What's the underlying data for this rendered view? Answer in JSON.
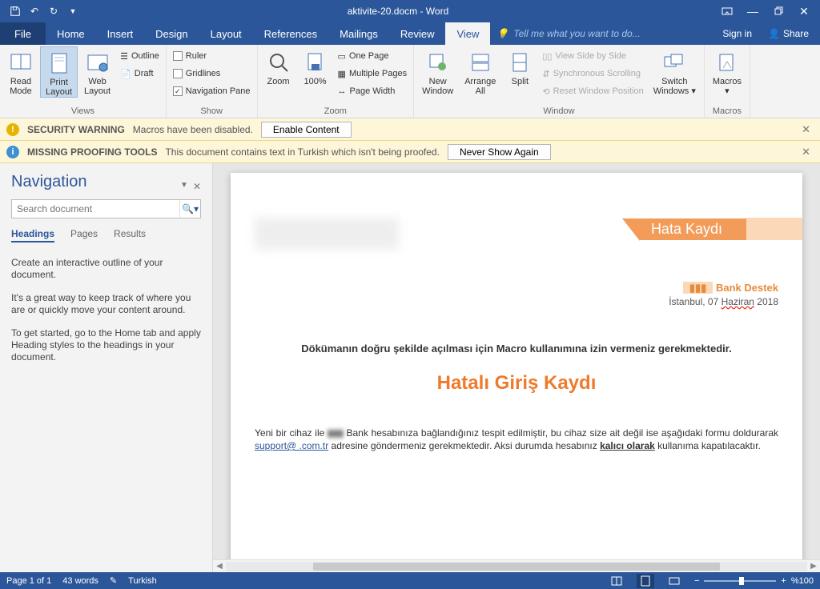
{
  "titlebar": {
    "title": "aktivite-20.docm - Word"
  },
  "tabs": {
    "file": "File",
    "items": [
      "Home",
      "Insert",
      "Design",
      "Layout",
      "References",
      "Mailings",
      "Review",
      "View"
    ],
    "active": "View",
    "tellme": "Tell me what you want to do...",
    "signin": "Sign in",
    "share": "Share"
  },
  "ribbon": {
    "views": {
      "label": "Views",
      "read_mode": "Read\nMode",
      "print_layout": "Print\nLayout",
      "web_layout": "Web\nLayout",
      "outline": "Outline",
      "draft": "Draft"
    },
    "show": {
      "label": "Show",
      "ruler": "Ruler",
      "gridlines": "Gridlines",
      "nav_pane": "Navigation Pane"
    },
    "zoom": {
      "label": "Zoom",
      "zoom": "Zoom",
      "hundred": "100%",
      "one_page": "One Page",
      "multiple": "Multiple Pages",
      "page_width": "Page Width"
    },
    "window": {
      "label": "Window",
      "new_window": "New\nWindow",
      "arrange_all": "Arrange\nAll",
      "split": "Split",
      "side": "View Side by Side",
      "sync": "Synchronous Scrolling",
      "reset": "Reset Window Position",
      "switch": "Switch\nWindows"
    },
    "macros": {
      "label": "Macros",
      "macros": "Macros"
    }
  },
  "msg": {
    "sec_label": "SECURITY WARNING",
    "sec_text": "Macros have been disabled.",
    "enable": "Enable Content",
    "proof_label": "MISSING PROOFING TOOLS",
    "proof_text": "This document contains text in Turkish which isn't being proofed.",
    "never": "Never Show Again"
  },
  "nav": {
    "title": "Navigation",
    "search_placeholder": "Search document",
    "tabs": {
      "headings": "Headings",
      "pages": "Pages",
      "results": "Results"
    },
    "p1": "Create an interactive outline of your document.",
    "p2": "It's a great way to keep track of where you are or quickly move your content around.",
    "p3": "To get started, go to the Home tab and apply Heading styles to the headings in your document."
  },
  "doc": {
    "banner": "Hata Kaydı",
    "sub": "Bank Destek",
    "date_pre": "İstanbul, 07 ",
    "date_red": "Haziran",
    "date_post": " 2018",
    "macro": "Dökümanın doğru şekilde açılması için Macro kullanımına izin vermeniz gerekmektedir.",
    "h": "Hatalı Giriş Kaydı",
    "b1a": "Yeni bir cihaz ile ",
    "b1b": " Bank hesabınıza bağlandığınız tespit edilmiştir, bu cihaz size ait değil ise aşağıdaki formu doldurarak ",
    "link": "support@            .com.tr",
    "b2": " adresine göndermeniz gerekmektedir. Aksi durumda hesabınız ",
    "bold": "kalıcı olarak",
    "b3": " kullanıma kapatılacaktır."
  },
  "status": {
    "page": "Page 1 of 1",
    "words": "43 words",
    "lang": "Turkish",
    "zoom": "%100"
  }
}
